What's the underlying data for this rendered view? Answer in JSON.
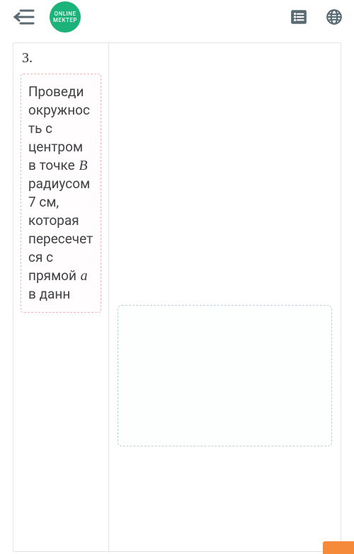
{
  "header": {
    "logo_line1": "ONLINE",
    "logo_line2": "MEKTEP"
  },
  "question": {
    "number": "3.",
    "text_before_B": "Проведи окружность с центром в точке ",
    "var_B": "B",
    "text_mid": " радиусом 7 см, которая пересечется с прямой ",
    "var_a": "a",
    "text_after_a": " в данн"
  }
}
